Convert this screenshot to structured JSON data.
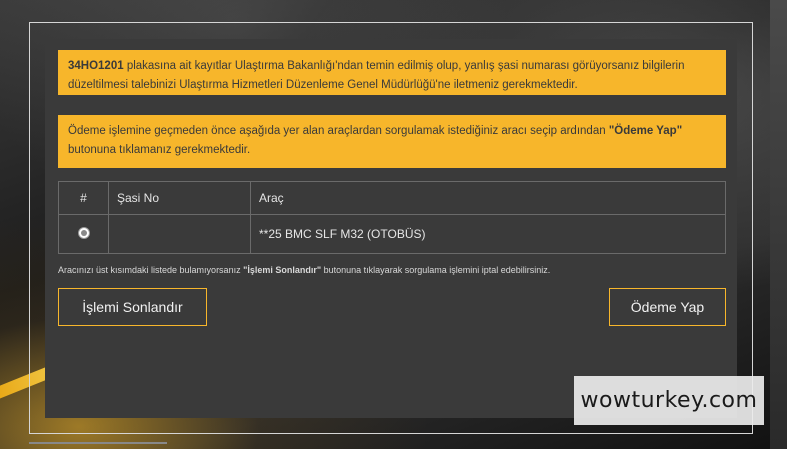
{
  "alerts": {
    "plate_alert": {
      "plate": "34HO1201",
      "text": " plakasına ait kayıtlar Ulaştırma Bakanlığı'ndan temin edilmiş olup, yanlış şasi numarası görüyorsanız bilgilerin düzeltilmesi talebinizi Ulaştırma Hizmetleri Düzenleme Genel Müdürlüğü'ne iletmeniz gerekmektedir."
    },
    "payment_alert": {
      "text_before": "Ödeme işlemine geçmeden önce aşağıda yer alan araçlardan sorgulamak istediğiniz aracı seçip ardından ",
      "bold": "\"Ödeme Yap\"",
      "text_after": " butonuna tıklamanız gerekmektedir."
    }
  },
  "table": {
    "headers": [
      "#",
      "Şasi No",
      "Araç"
    ],
    "rows": [
      {
        "chassis": "",
        "vehicle": "**25 BMC SLF M32 (OTOBÜS)"
      }
    ]
  },
  "note": {
    "text_before": "Aracınızı üst kısımdaki listede bulamıyorsanız ",
    "bold": "\"İşlemi Sonlandır\"",
    "text_after": " butonuna tıklayarak sorgulama işlemini iptal edebilirsiniz."
  },
  "buttons": {
    "cancel_label": "İşlemi Sonlandır",
    "pay_label": "Ödeme Yap"
  },
  "watermark": "wowturkey.com",
  "colors": {
    "alert_bg": "#f7b62b",
    "panel_bg": "#3a3a3a",
    "button_border": "#f7b62b"
  }
}
